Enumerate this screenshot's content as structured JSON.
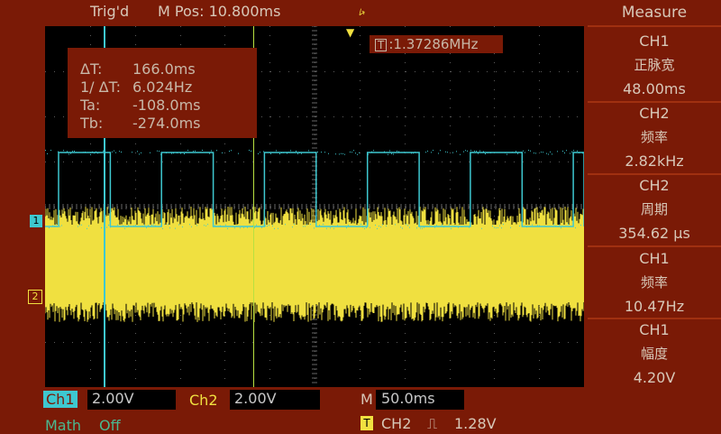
{
  "status": {
    "trigger_state": "Trig'd",
    "mpos": "M Pos: 10.800ms",
    "usb_icon": "usb-icon"
  },
  "cursor_readout": {
    "rows": [
      {
        "key": "ΔT:",
        "value": "166.0ms"
      },
      {
        "key": "1/ ΔT:",
        "value": "6.024Hz"
      },
      {
        "key": "Ta:",
        "value": "-108.0ms"
      },
      {
        "key": "Tb:",
        "value": "-274.0ms"
      }
    ]
  },
  "trigger_freq": {
    "tag": "T",
    "value": ":1.37286MHz"
  },
  "markers": {
    "ch1": "1",
    "ch2": "2"
  },
  "bottom": {
    "ch1_label": "Ch1",
    "ch1_scale": "2.00V",
    "ch2_label": "Ch2",
    "ch2_scale": "2.00V",
    "m_label": "M",
    "m_scale": "50.0ms",
    "math_label": "Math",
    "math_state": "Off",
    "trig_icon": "T",
    "trig_source": "CH2",
    "trig_edge": "⎍",
    "trig_level": "1.28V"
  },
  "measure": {
    "title": "Measure",
    "items": [
      {
        "source": "CH1",
        "type": "正脉宽",
        "value": "48.00ms"
      },
      {
        "source": "CH2",
        "type": "频率",
        "value": "2.82kHz"
      },
      {
        "source": "CH2",
        "type": "周期",
        "value": "354.62 µs"
      },
      {
        "source": "CH1",
        "type": "频率",
        "value": "10.47Hz"
      },
      {
        "source": "CH1",
        "type": "幅度",
        "value": "4.20V"
      }
    ]
  },
  "colors": {
    "background": "#7a1a06",
    "ch1": "#3ec8d0",
    "ch2": "#f0e040"
  },
  "waveform": {
    "ch1_period_ms": 95.5,
    "ch1_high_ms": 48.0,
    "ch1_amplitude_v": 4.2,
    "ch2_frequency_khz": 2.82,
    "ch2_noise_band": "full"
  }
}
